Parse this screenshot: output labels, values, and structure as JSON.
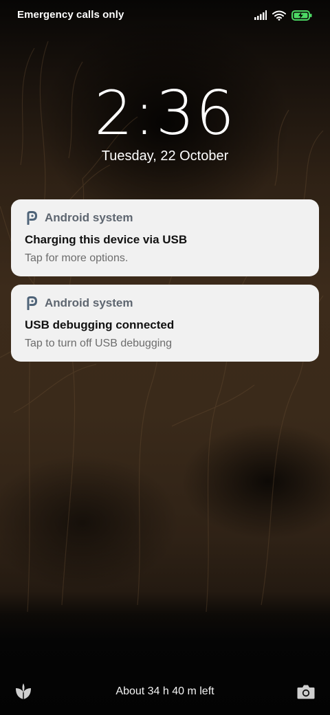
{
  "status_bar": {
    "carrier_text": "Emergency calls only",
    "icons": [
      "signal-icon",
      "wifi-icon",
      "battery-charging-icon"
    ]
  },
  "lockscreen": {
    "time": "2:36",
    "date": "Tuesday, 22 October"
  },
  "notifications": [
    {
      "app_name": "Android system",
      "icon": "android-system-icon",
      "title": "Charging this device via USB",
      "body": "Tap for more options."
    },
    {
      "app_name": "Android system",
      "icon": "android-system-icon",
      "title": "USB debugging connected",
      "body": "Tap to turn off USB debugging"
    }
  ],
  "bottom_bar": {
    "battery_estimate": "About 34 h 40 m left",
    "left_shortcut_icon": "leaf-icon",
    "right_shortcut_icon": "camera-icon"
  },
  "colors": {
    "notification_bg": "#f1f1f1",
    "app_name_color": "#5e6670",
    "battery_accent": "#4cd964"
  }
}
